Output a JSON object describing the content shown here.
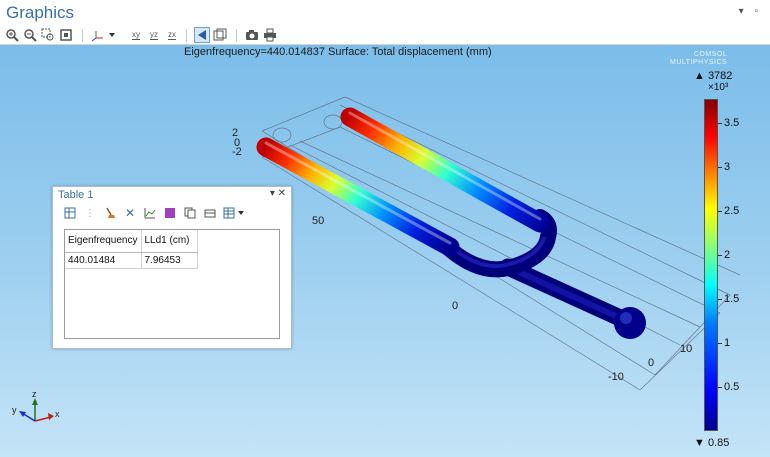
{
  "panel": {
    "title": "Graphics"
  },
  "plot": {
    "title": "Eigenfrequency=440.014837   Surface: Total displacement (mm)",
    "brand_line1": "COMSOL",
    "brand_line2": "MULTIPHYSICS"
  },
  "colorbar": {
    "max_label": "▲ 3782",
    "exponent": "×10³",
    "min_label": "▼ 0.85",
    "ticks": [
      "3.5",
      "3",
      "2.5",
      "2",
      "1.5",
      "1",
      "0.5"
    ]
  },
  "axes": {
    "labels": [
      "2",
      "0",
      "-2",
      "50",
      "0",
      "0",
      "10",
      "-10"
    ],
    "triad": {
      "z": "z",
      "y": "y",
      "x": "x"
    }
  },
  "table_window": {
    "title": "Table 1",
    "columns": [
      "Eigenfrequency",
      "LLd1 (cm)"
    ],
    "rows": [
      [
        "440.01484",
        "7.96453"
      ]
    ]
  },
  "colors": {
    "accent": "#3b6ea5",
    "viewport_top": "#7bbde9",
    "viewport_bottom": "#c4e4f7"
  }
}
